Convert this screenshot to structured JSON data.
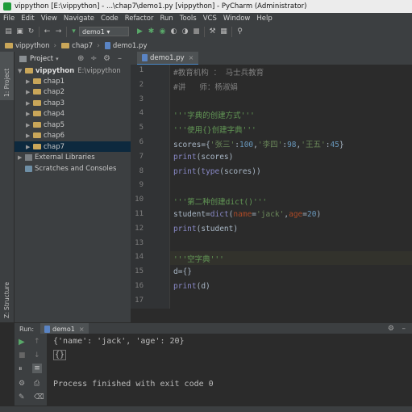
{
  "window": {
    "title": "vippython [E:\\vippython] - ...\\chap7\\demo1.py [vippython] - PyCharm (Administrator)"
  },
  "menu": [
    "File",
    "Edit",
    "View",
    "Navigate",
    "Code",
    "Refactor",
    "Run",
    "Tools",
    "VCS",
    "Window",
    "Help"
  ],
  "toolbar": {
    "run_config": "demo1"
  },
  "breadcrumb": [
    "vippython",
    "chap7",
    "demo1.py"
  ],
  "left_stripe": {
    "project_label": "1: Project",
    "structure_label": "Z: Structure",
    "favorites_label": "2: Favorites"
  },
  "project": {
    "header": "Project",
    "root": {
      "name": "vippython",
      "path": "E:\\vippython"
    },
    "folders": [
      "chap1",
      "chap2",
      "chap3",
      "chap4",
      "chap5",
      "chap6",
      "chap7"
    ],
    "selected": "chap7",
    "external": "External Libraries",
    "scratches": "Scratches and Consoles"
  },
  "editor": {
    "tab": "demo1.py",
    "lines": [
      {
        "n": "1",
        "segs": [
          {
            "t": "#教育机构 ： 马士兵教育",
            "c": "comment"
          }
        ]
      },
      {
        "n": "2",
        "segs": [
          {
            "t": "#讲   师：杨淑娟",
            "c": "comment"
          }
        ]
      },
      {
        "n": "3",
        "segs": []
      },
      {
        "n": "4",
        "segs": [
          {
            "t": "'''字典的创建方式'''",
            "c": "doc"
          }
        ]
      },
      {
        "n": "5",
        "segs": [
          {
            "t": "'''使用{}创建字典'''",
            "c": "doc"
          }
        ]
      },
      {
        "n": "6",
        "segs": [
          {
            "t": "scores",
            "c": "plain"
          },
          {
            "t": "=",
            "c": "plain"
          },
          {
            "t": "{",
            "c": "plain"
          },
          {
            "t": "'张三'",
            "c": "str"
          },
          {
            "t": ":",
            "c": "plain"
          },
          {
            "t": "100",
            "c": "num"
          },
          {
            "t": ",",
            "c": "plain"
          },
          {
            "t": "'李四'",
            "c": "str"
          },
          {
            "t": ":",
            "c": "plain"
          },
          {
            "t": "98",
            "c": "num"
          },
          {
            "t": ",",
            "c": "plain"
          },
          {
            "t": "'王五'",
            "c": "str"
          },
          {
            "t": ":",
            "c": "plain"
          },
          {
            "t": "45",
            "c": "num"
          },
          {
            "t": "}",
            "c": "plain"
          }
        ]
      },
      {
        "n": "7",
        "segs": [
          {
            "t": "print",
            "c": "builtin"
          },
          {
            "t": "(scores)",
            "c": "plain"
          }
        ]
      },
      {
        "n": "8",
        "segs": [
          {
            "t": "print",
            "c": "builtin"
          },
          {
            "t": "(",
            "c": "plain"
          },
          {
            "t": "type",
            "c": "builtin"
          },
          {
            "t": "(scores))",
            "c": "plain"
          }
        ]
      },
      {
        "n": "9",
        "segs": []
      },
      {
        "n": "10",
        "segs": [
          {
            "t": "'''第二种创建dict()'''",
            "c": "doc"
          }
        ]
      },
      {
        "n": "11",
        "segs": [
          {
            "t": "student",
            "c": "plain"
          },
          {
            "t": "=",
            "c": "plain"
          },
          {
            "t": "dict",
            "c": "builtin"
          },
          {
            "t": "(",
            "c": "plain"
          },
          {
            "t": "name",
            "c": "kw"
          },
          {
            "t": "=",
            "c": "plain"
          },
          {
            "t": "'jack'",
            "c": "str"
          },
          {
            "t": ",",
            "c": "plain"
          },
          {
            "t": "age",
            "c": "kw"
          },
          {
            "t": "=",
            "c": "plain"
          },
          {
            "t": "20",
            "c": "num"
          },
          {
            "t": ")",
            "c": "plain"
          }
        ]
      },
      {
        "n": "12",
        "segs": [
          {
            "t": "print",
            "c": "builtin"
          },
          {
            "t": "(student)",
            "c": "plain"
          }
        ]
      },
      {
        "n": "13",
        "segs": []
      },
      {
        "n": "14",
        "segs": [
          {
            "t": "'''空字典'''",
            "c": "doc"
          }
        ]
      },
      {
        "n": "15",
        "segs": [
          {
            "t": "d",
            "c": "plain"
          },
          {
            "t": "=",
            "c": "plain"
          },
          {
            "t": "{}",
            "c": "plain"
          }
        ]
      },
      {
        "n": "16",
        "segs": [
          {
            "t": "print",
            "c": "builtin"
          },
          {
            "t": "(d)",
            "c": "plain"
          }
        ]
      },
      {
        "n": "17",
        "segs": []
      }
    ],
    "current_line": "14"
  },
  "run": {
    "label": "Run:",
    "tab": "demo1",
    "output": [
      "{'name': 'jack', 'age': 20}",
      "{}",
      "",
      "Process finished with exit code 0"
    ]
  },
  "colors": {
    "accent": "#4a88c7",
    "selection": "#0d293e",
    "run_green": "#59a869"
  }
}
